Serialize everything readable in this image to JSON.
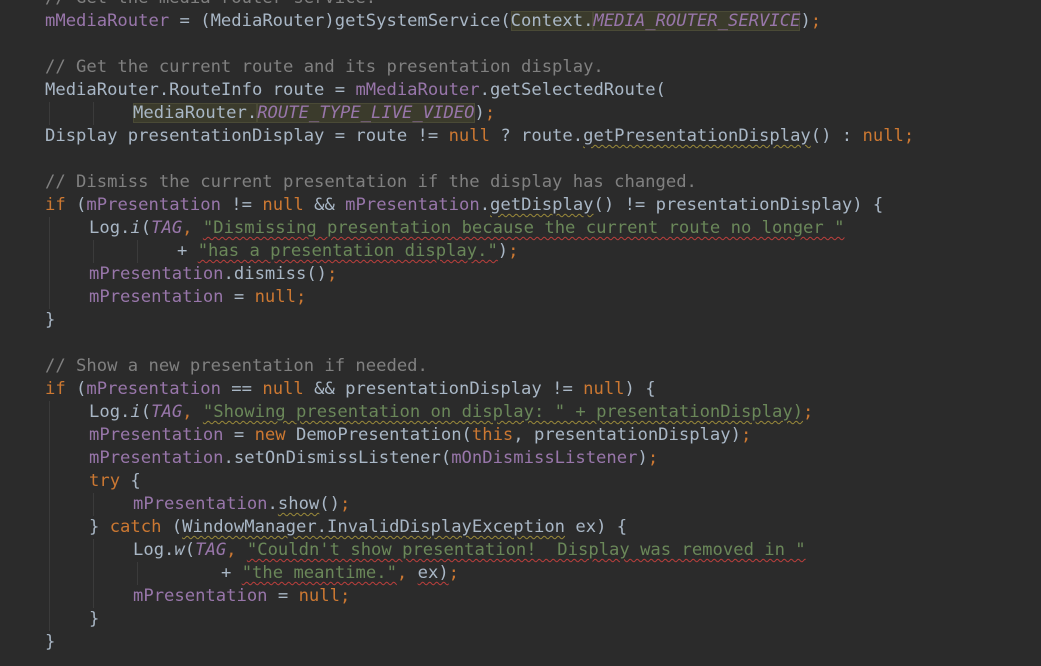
{
  "editor": {
    "background": "#2b2b2b",
    "colors": {
      "plain": "#a9b7c6",
      "comment": "#808080",
      "keyword": "#cc7832",
      "field": "#9876aa",
      "string": "#6a8759",
      "error_underline": "#bc3f3c"
    },
    "lines": [
      {
        "indent": 0,
        "tokens": [
          {
            "t": "// Get the media router service.",
            "c": "comment"
          }
        ]
      },
      {
        "indent": 0,
        "tokens": [
          {
            "t": "mMediaRouter",
            "c": "field"
          },
          {
            "t": " = (MediaRouter)getSystemService(",
            "c": "plain"
          },
          {
            "t": "Context.",
            "c": "plain",
            "hl": 1
          },
          {
            "t": "MEDIA_ROUTER_SERVICE",
            "c": "static",
            "hl": 1
          },
          {
            "t": ")",
            "c": "plain"
          },
          {
            "t": ";",
            "c": "keyword"
          }
        ]
      },
      {
        "indent": 0,
        "tokens": []
      },
      {
        "indent": 0,
        "tokens": [
          {
            "t": "// Get the current route and its presentation display.",
            "c": "comment"
          }
        ]
      },
      {
        "indent": 0,
        "tokens": [
          {
            "t": "MediaRouter.RouteInfo route = ",
            "c": "plain"
          },
          {
            "t": "mMediaRouter",
            "c": "field"
          },
          {
            "t": ".getSelectedRoute(",
            "c": "plain"
          }
        ]
      },
      {
        "indent": 2,
        "tokens": [
          {
            "t": "MediaRouter.",
            "c": "plain",
            "hl": 1
          },
          {
            "t": "ROUTE_TYPE_LIVE_VIDEO",
            "c": "static",
            "hl": 1
          },
          {
            "t": ")",
            "c": "plain"
          },
          {
            "t": ";",
            "c": "keyword"
          }
        ]
      },
      {
        "indent": 0,
        "tokens": [
          {
            "t": "Display presentationDisplay = route != ",
            "c": "plain"
          },
          {
            "t": "null",
            "c": "keyword"
          },
          {
            "t": " ? route.",
            "c": "plain"
          },
          {
            "t": "getPresentationDisplay",
            "c": "plain",
            "u": "warn"
          },
          {
            "t": "() : ",
            "c": "plain"
          },
          {
            "t": "null",
            "c": "keyword"
          },
          {
            "t": ";",
            "c": "keyword"
          }
        ]
      },
      {
        "indent": 0,
        "tokens": []
      },
      {
        "indent": 0,
        "tokens": [
          {
            "t": "// Dismiss the current presentation if the display has changed.",
            "c": "comment"
          }
        ]
      },
      {
        "indent": 0,
        "tokens": [
          {
            "t": "if",
            "c": "keyword"
          },
          {
            "t": " (",
            "c": "plain"
          },
          {
            "t": "mPresentation",
            "c": "field"
          },
          {
            "t": " != ",
            "c": "plain"
          },
          {
            "t": "null",
            "c": "keyword"
          },
          {
            "t": " && ",
            "c": "plain"
          },
          {
            "t": "mPresentation",
            "c": "field"
          },
          {
            "t": ".",
            "c": "plain"
          },
          {
            "t": "getDisplay",
            "c": "plain",
            "u": "warn"
          },
          {
            "t": "() != presentationDisplay) {",
            "c": "plain"
          }
        ]
      },
      {
        "indent": 1,
        "tokens": [
          {
            "t": "Log.",
            "c": "plain"
          },
          {
            "t": "i",
            "c": "method-static"
          },
          {
            "t": "(",
            "c": "plain"
          },
          {
            "t": "TAG",
            "c": "static"
          },
          {
            "t": ", ",
            "c": "keyword"
          },
          {
            "t": "\"Dismissing presentation because the current route no longer \"",
            "c": "string",
            "u": "err"
          }
        ]
      },
      {
        "indent": 3,
        "tokens": [
          {
            "t": "+ ",
            "c": "plain"
          },
          {
            "t": "\"has a presentation display.\"",
            "c": "string",
            "u": "err"
          },
          {
            "t": ")",
            "c": "plain"
          },
          {
            "t": ";",
            "c": "keyword"
          }
        ]
      },
      {
        "indent": 1,
        "tokens": [
          {
            "t": "mPresentation",
            "c": "field"
          },
          {
            "t": ".dismiss()",
            "c": "plain"
          },
          {
            "t": ";",
            "c": "keyword"
          }
        ]
      },
      {
        "indent": 1,
        "tokens": [
          {
            "t": "mPresentation",
            "c": "field"
          },
          {
            "t": " = ",
            "c": "plain"
          },
          {
            "t": "null",
            "c": "keyword"
          },
          {
            "t": ";",
            "c": "keyword"
          }
        ]
      },
      {
        "indent": 0,
        "tokens": [
          {
            "t": "}",
            "c": "plain"
          }
        ]
      },
      {
        "indent": 0,
        "tokens": []
      },
      {
        "indent": 0,
        "tokens": [
          {
            "t": "// Show a new presentation if needed.",
            "c": "comment"
          }
        ]
      },
      {
        "indent": 0,
        "tokens": [
          {
            "t": "if",
            "c": "keyword"
          },
          {
            "t": " (",
            "c": "plain"
          },
          {
            "t": "mPresentation",
            "c": "field"
          },
          {
            "t": " == ",
            "c": "plain"
          },
          {
            "t": "null",
            "c": "keyword"
          },
          {
            "t": " && presentationDisplay != ",
            "c": "plain"
          },
          {
            "t": "null",
            "c": "keyword"
          },
          {
            "t": ") {",
            "c": "plain"
          }
        ]
      },
      {
        "indent": 1,
        "tokens": [
          {
            "t": "Log.",
            "c": "plain"
          },
          {
            "t": "i",
            "c": "method-static"
          },
          {
            "t": "(",
            "c": "plain"
          },
          {
            "t": "TAG",
            "c": "static"
          },
          {
            "t": ", ",
            "c": "keyword"
          },
          {
            "t": "\"Showing presentation on display: \" + presentationDisplay)",
            "c": "string",
            "u": "warn"
          },
          {
            "t": ";",
            "c": "keyword"
          }
        ]
      },
      {
        "indent": 1,
        "tokens": [
          {
            "t": "mPresentation",
            "c": "field"
          },
          {
            "t": " = ",
            "c": "plain"
          },
          {
            "t": "new",
            "c": "keyword"
          },
          {
            "t": " DemoPresentation(",
            "c": "plain"
          },
          {
            "t": "this",
            "c": "keyword"
          },
          {
            "t": ", presentationDisplay)",
            "c": "plain"
          },
          {
            "t": ";",
            "c": "keyword"
          }
        ]
      },
      {
        "indent": 1,
        "tokens": [
          {
            "t": "mPresentation",
            "c": "field"
          },
          {
            "t": ".setOnDismissListener(",
            "c": "plain"
          },
          {
            "t": "mOnDismissListener",
            "c": "field"
          },
          {
            "t": ")",
            "c": "plain"
          },
          {
            "t": ";",
            "c": "keyword"
          }
        ]
      },
      {
        "indent": 1,
        "tokens": [
          {
            "t": "try",
            "c": "keyword"
          },
          {
            "t": " {",
            "c": "plain"
          }
        ]
      },
      {
        "indent": 2,
        "tokens": [
          {
            "t": "mPresentation",
            "c": "field"
          },
          {
            "t": ".",
            "c": "plain"
          },
          {
            "t": "show",
            "c": "plain",
            "u": "warn"
          },
          {
            "t": "()",
            "c": "plain"
          },
          {
            "t": ";",
            "c": "keyword"
          }
        ]
      },
      {
        "indent": 1,
        "tokens": [
          {
            "t": "} ",
            "c": "plain"
          },
          {
            "t": "catch",
            "c": "keyword"
          },
          {
            "t": " (",
            "c": "plain"
          },
          {
            "t": "WindowManager.InvalidDisplayException",
            "c": "plain",
            "u": "warn"
          },
          {
            "t": " ex) {",
            "c": "plain"
          }
        ]
      },
      {
        "indent": 2,
        "tokens": [
          {
            "t": "Log.",
            "c": "plain"
          },
          {
            "t": "w",
            "c": "method-static"
          },
          {
            "t": "(",
            "c": "plain"
          },
          {
            "t": "TAG",
            "c": "static"
          },
          {
            "t": ", ",
            "c": "keyword"
          },
          {
            "t": "\"Couldn't show presentation!  Display was removed in \"",
            "c": "string",
            "u": "err"
          }
        ]
      },
      {
        "indent": 4,
        "tokens": [
          {
            "t": "+ ",
            "c": "plain"
          },
          {
            "t": "\"the meantime.\"",
            "c": "string",
            "u": "err"
          },
          {
            "t": ", ",
            "c": "keyword"
          },
          {
            "t": "ex)",
            "c": "plain",
            "u": "err"
          },
          {
            "t": ";",
            "c": "keyword"
          }
        ]
      },
      {
        "indent": 2,
        "tokens": [
          {
            "t": "mPresentation",
            "c": "field"
          },
          {
            "t": " = ",
            "c": "plain"
          },
          {
            "t": "null",
            "c": "keyword"
          },
          {
            "t": ";",
            "c": "keyword"
          }
        ]
      },
      {
        "indent": 1,
        "tokens": [
          {
            "t": "}",
            "c": "plain"
          }
        ]
      },
      {
        "indent": 0,
        "tokens": [
          {
            "t": "}",
            "c": "plain"
          }
        ]
      }
    ]
  }
}
